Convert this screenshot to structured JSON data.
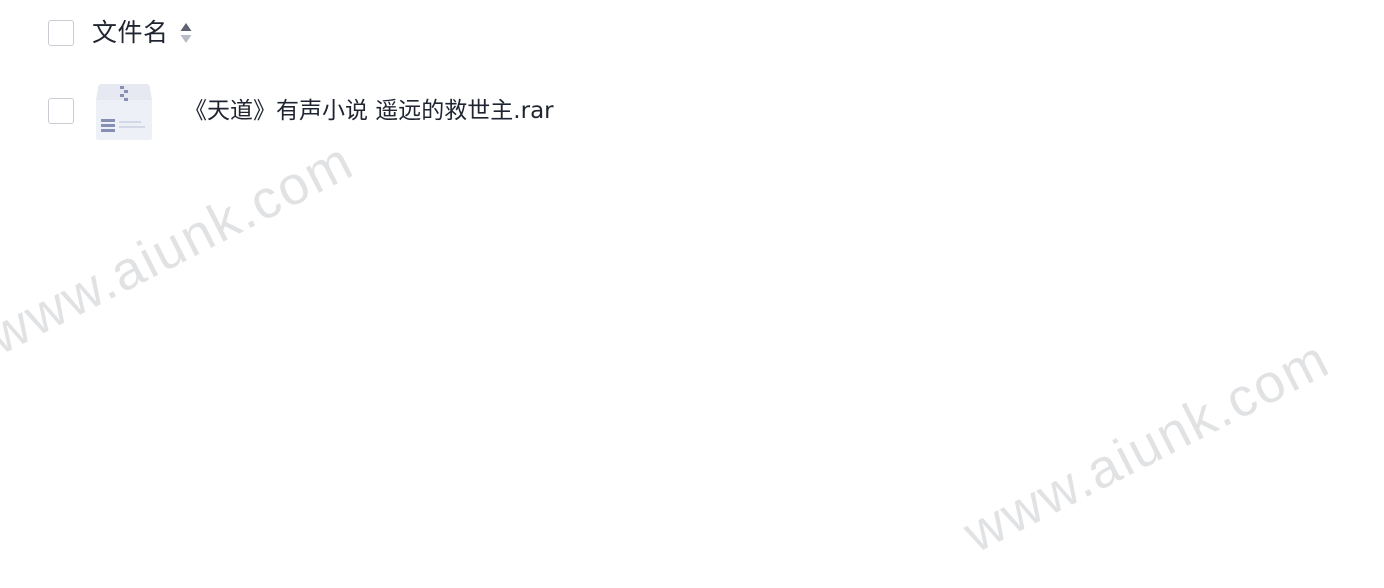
{
  "file_list": {
    "header": {
      "column_label": "文件名",
      "sort_icon": "sort-toggle-icon"
    },
    "files": [
      {
        "name": "《天道》有声小说 遥远的救世主.rar",
        "icon": "archive-file-icon"
      }
    ]
  },
  "watermark": {
    "text": "www.aiunk.com"
  },
  "colors": {
    "text": "#1f2430",
    "checkbox_border": "#c9ccd3",
    "icon_body": "#e6e9f2",
    "icon_accent": "#8790b3"
  }
}
